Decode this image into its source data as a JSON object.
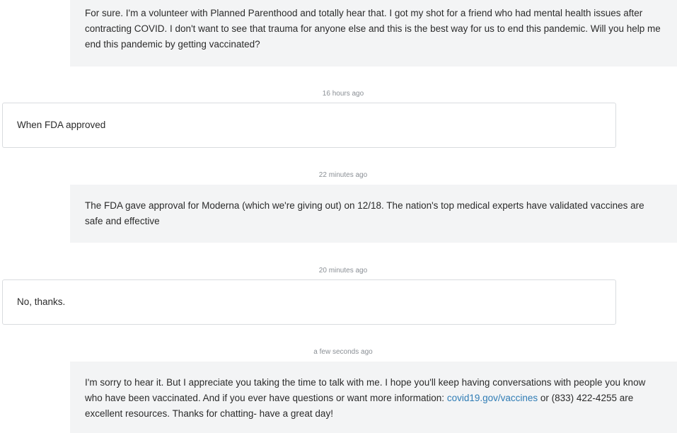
{
  "messages": [
    {
      "direction": "outgoing",
      "text": "For sure. I'm a volunteer with Planned Parenthood and totally hear that. I got my shot for a friend who had mental health issues after contracting COVID. I don't want to see that trauma for anyone else and this is the best way for us to end this pandemic. Will you help me end this pandemic by getting vaccinated?"
    },
    {
      "direction": "incoming",
      "timestamp": "16 hours ago",
      "text": "When FDA approved"
    },
    {
      "direction": "outgoing",
      "timestamp": "22 minutes ago",
      "text": "The FDA gave approval for Moderna (which we're giving out) on 12/18. The nation's top medical experts have validated vaccines are safe and effective"
    },
    {
      "direction": "incoming",
      "timestamp": "20 minutes ago",
      "text": "No, thanks."
    },
    {
      "direction": "outgoing",
      "timestamp": "a few seconds ago",
      "text_before_link": "I'm sorry to hear it. But I appreciate you taking the time to talk with me. I hope you'll keep having conversations with people you know who have been vaccinated. And if you ever have questions or want more information: ",
      "link_text": "covid19.gov/vaccines",
      "text_after_link": " or (833) 422-4255 are excellent resources. Thanks for chatting- have a great day!"
    }
  ]
}
